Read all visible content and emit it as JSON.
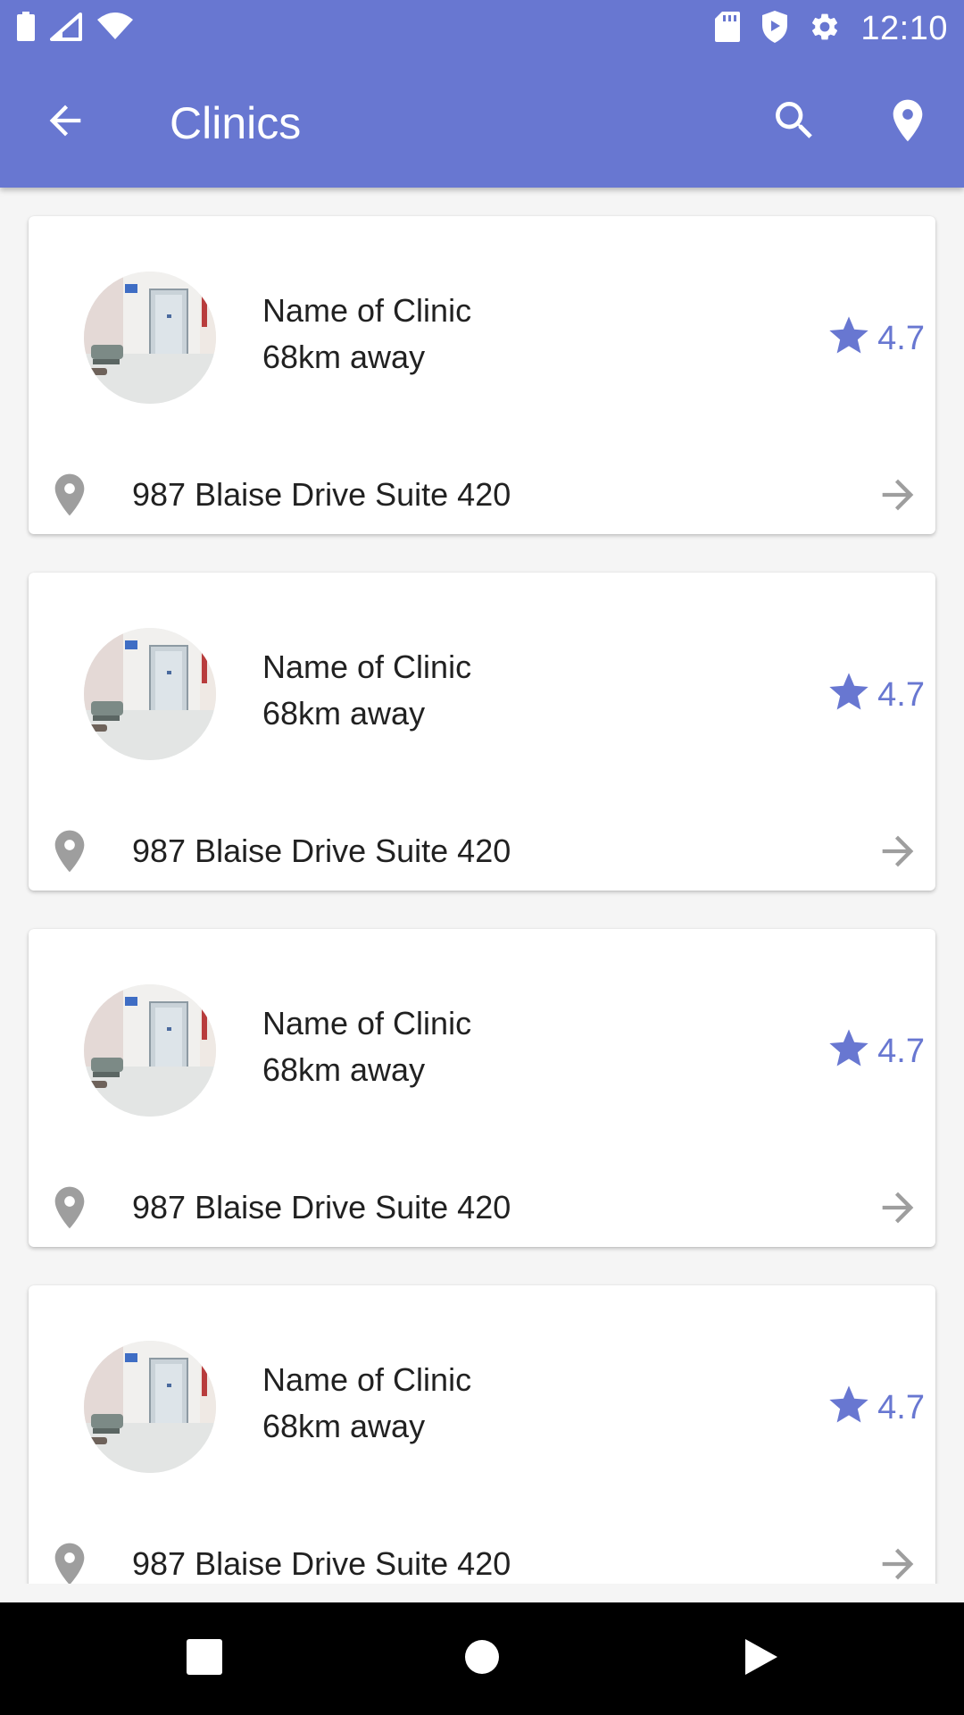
{
  "status_bar": {
    "time": "12:10",
    "left_icons": [
      "battery-icon",
      "signal-icon",
      "wifi-icon"
    ],
    "right_icons": [
      "sd-card-icon",
      "shield-icon",
      "settings-icon"
    ]
  },
  "toolbar": {
    "title": "Clinics",
    "back_icon": "arrow-back-icon",
    "search_icon": "search-icon",
    "map_icon": "location-pin-icon",
    "background_color": "#6877d1"
  },
  "clinics": [
    {
      "name": "Name of Clinic",
      "distance": "68km away",
      "rating": "4.7",
      "address": "987 Blaise Drive Suite 420"
    },
    {
      "name": "Name of Clinic",
      "distance": "68km away",
      "rating": "4.7",
      "address": "987 Blaise Drive Suite 420"
    },
    {
      "name": "Name of Clinic",
      "distance": "68km away",
      "rating": "4.7",
      "address": "987 Blaise Drive Suite 420"
    },
    {
      "name": "Name of Clinic",
      "distance": "68km away",
      "rating": "4.7",
      "address": "987 Blaise Drive Suite 420"
    }
  ],
  "colors": {
    "accent": "#6877d1",
    "secondary_icon": "#9e9e9e",
    "background": "#f5f5f5",
    "card": "#ffffff"
  },
  "navigation_bar": {
    "icons": [
      "overview-icon",
      "home-icon",
      "back-triangle-icon"
    ]
  }
}
